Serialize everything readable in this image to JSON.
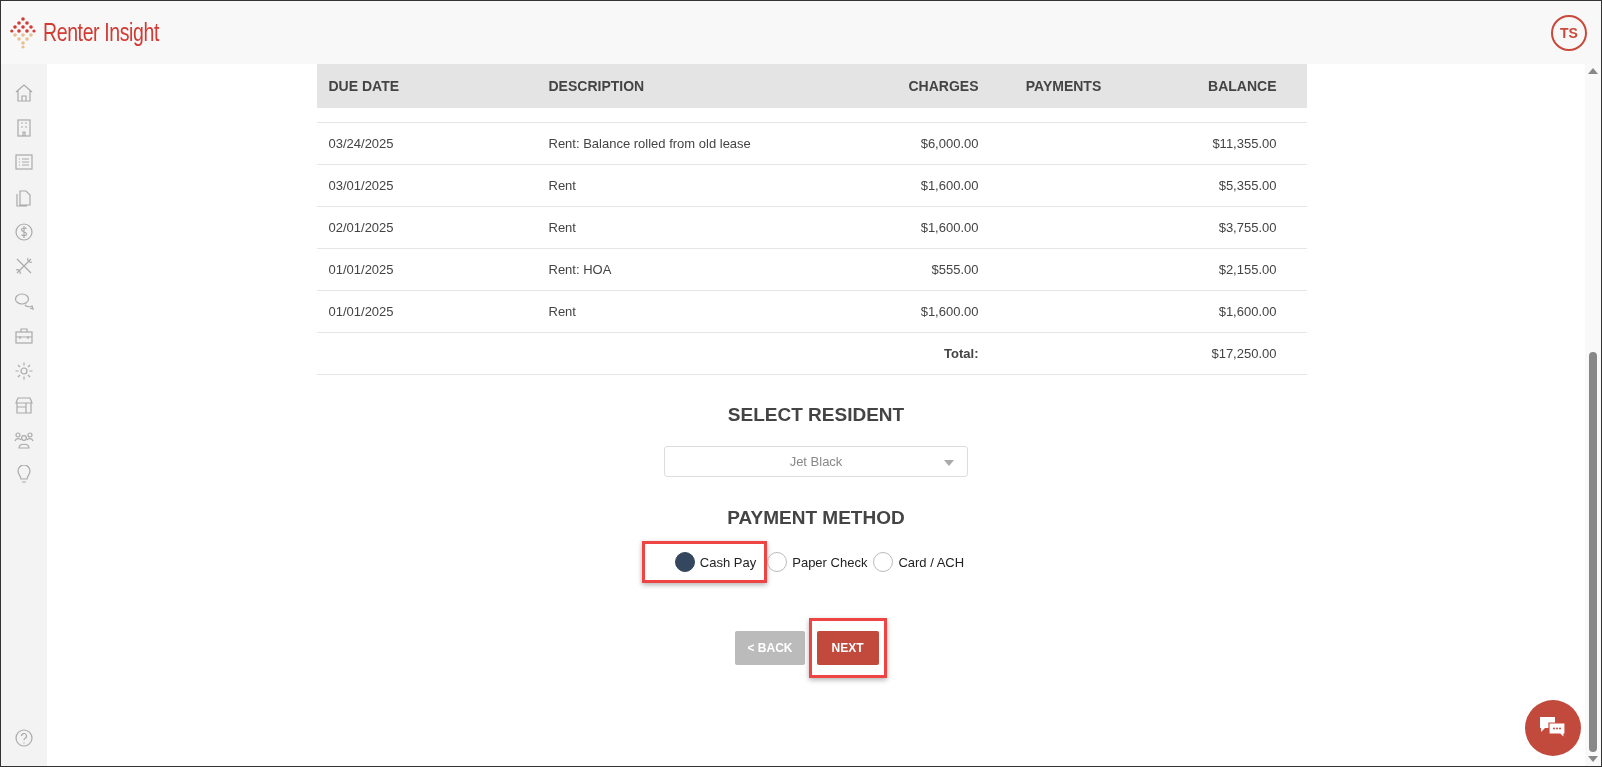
{
  "header": {
    "logo_text": "Renter Insight",
    "avatar_initials": "TS"
  },
  "table": {
    "columns": [
      "DUE DATE",
      "DESCRIPTION",
      "CHARGES",
      "PAYMENTS",
      "BALANCE"
    ],
    "rows": [
      {
        "due_date": "03/24/2025",
        "description": "Rent: Balance rolled from old lease",
        "charges": "$6,000.00",
        "payments": "",
        "balance": "$11,355.00"
      },
      {
        "due_date": "03/01/2025",
        "description": "Rent",
        "charges": "$1,600.00",
        "payments": "",
        "balance": "$5,355.00"
      },
      {
        "due_date": "02/01/2025",
        "description": "Rent",
        "charges": "$1,600.00",
        "payments": "",
        "balance": "$3,755.00"
      },
      {
        "due_date": "01/01/2025",
        "description": "Rent: HOA",
        "charges": "$555.00",
        "payments": "",
        "balance": "$2,155.00"
      },
      {
        "due_date": "01/01/2025",
        "description": "Rent",
        "charges": "$1,600.00",
        "payments": "",
        "balance": "$1,600.00"
      }
    ],
    "total_label": "Total:",
    "total_balance": "$17,250.00"
  },
  "resident": {
    "heading": "SELECT RESIDENT",
    "value": "Jet Black"
  },
  "payment": {
    "heading": "PAYMENT METHOD",
    "options": [
      {
        "label": "Cash Pay",
        "selected": true,
        "highlighted": true
      },
      {
        "label": "Paper Check",
        "selected": false,
        "highlighted": false
      },
      {
        "label": "Card / ACH",
        "selected": false,
        "highlighted": false
      }
    ]
  },
  "buttons": [
    {
      "label": "< BACK",
      "kind": "back",
      "highlighted": false
    },
    {
      "label": "NEXT",
      "kind": "next",
      "highlighted": true
    }
  ]
}
